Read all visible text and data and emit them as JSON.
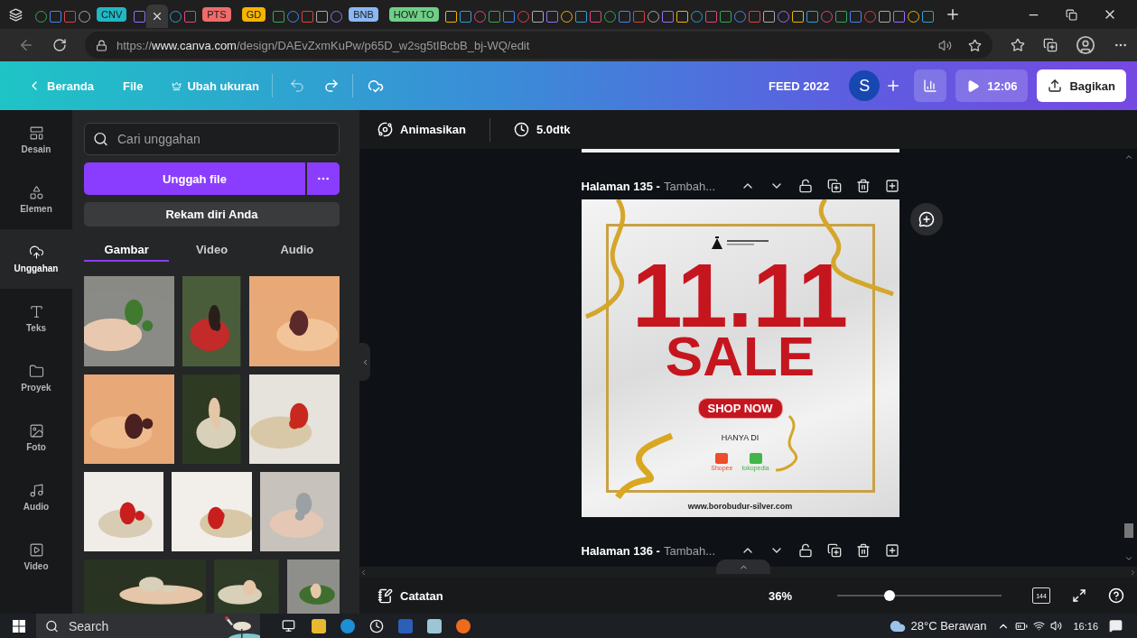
{
  "browser": {
    "tabs": [
      {
        "kind": "tab",
        "selected": false
      },
      {
        "kind": "tab",
        "selected": false
      },
      {
        "kind": "tab",
        "selected": false
      },
      {
        "kind": "tab",
        "selected": false
      },
      {
        "kind": "group",
        "label": "CNV",
        "color": "#20b8c4"
      },
      {
        "kind": "tab",
        "selected": false
      },
      {
        "kind": "tab",
        "selected": true
      },
      {
        "kind": "tab",
        "selected": false
      },
      {
        "kind": "tab",
        "selected": false
      },
      {
        "kind": "group",
        "label": "PTS",
        "color": "#f06b6b"
      },
      {
        "kind": "group",
        "label": "GD",
        "color": "#f5b400"
      },
      {
        "kind": "tab",
        "selected": false
      },
      {
        "kind": "tab",
        "selected": false
      },
      {
        "kind": "tab",
        "selected": false
      },
      {
        "kind": "tab",
        "selected": false
      },
      {
        "kind": "tab",
        "selected": false
      },
      {
        "kind": "group",
        "label": "BNB",
        "color": "#8ab8f5"
      },
      {
        "kind": "group",
        "label": "HOW TO",
        "color": "#6fcf86"
      },
      {
        "kind": "tab",
        "selected": false
      },
      {
        "kind": "tab",
        "selected": false
      },
      {
        "kind": "tab",
        "selected": false
      },
      {
        "kind": "tab",
        "selected": false
      },
      {
        "kind": "tab",
        "selected": false
      },
      {
        "kind": "tab",
        "selected": false
      },
      {
        "kind": "tab",
        "selected": false
      },
      {
        "kind": "tab",
        "selected": false
      },
      {
        "kind": "tab",
        "selected": false
      },
      {
        "kind": "tab",
        "selected": false
      },
      {
        "kind": "tab",
        "selected": false
      },
      {
        "kind": "tab",
        "selected": false
      },
      {
        "kind": "tab",
        "selected": false
      },
      {
        "kind": "tab",
        "selected": false
      },
      {
        "kind": "tab",
        "selected": false
      },
      {
        "kind": "tab",
        "selected": false
      },
      {
        "kind": "tab",
        "selected": false
      },
      {
        "kind": "tab",
        "selected": false
      },
      {
        "kind": "tab",
        "selected": false
      },
      {
        "kind": "tab",
        "selected": false
      },
      {
        "kind": "tab",
        "selected": false
      },
      {
        "kind": "tab",
        "selected": false
      },
      {
        "kind": "tab",
        "selected": false
      },
      {
        "kind": "tab",
        "selected": false
      },
      {
        "kind": "tab",
        "selected": false
      },
      {
        "kind": "tab",
        "selected": false
      },
      {
        "kind": "tab",
        "selected": false
      },
      {
        "kind": "tab",
        "selected": false
      },
      {
        "kind": "tab",
        "selected": false
      },
      {
        "kind": "tab",
        "selected": false
      },
      {
        "kind": "tab",
        "selected": false
      },
      {
        "kind": "tab",
        "selected": false
      },
      {
        "kind": "tab",
        "selected": false
      },
      {
        "kind": "tab",
        "selected": false
      }
    ],
    "url": {
      "scheme": "https://",
      "host": "www.canva.com",
      "path": "/design/DAEvZxmKuPw/p65D_w2sg5tIBcbB_bj-WQ/edit"
    }
  },
  "header": {
    "back_label": "Beranda",
    "file_label": "File",
    "resize_label": "Ubah ukuran",
    "design_title": "FEED 2022",
    "avatar": "S",
    "timer": "12:06",
    "share_label": "Bagikan"
  },
  "rail": [
    {
      "label": "Desain",
      "selected": false
    },
    {
      "label": "Elemen",
      "selected": false
    },
    {
      "label": "Unggahan",
      "selected": true
    },
    {
      "label": "Teks",
      "selected": false
    },
    {
      "label": "Proyek",
      "selected": false
    },
    {
      "label": "Foto",
      "selected": false
    },
    {
      "label": "Audio",
      "selected": false
    },
    {
      "label": "Video",
      "selected": false
    }
  ],
  "panel": {
    "search_placeholder": "Cari unggahan",
    "upload_label": "Unggah file",
    "record_label": "Rekam diri Anda",
    "tabs": [
      {
        "label": "Gambar",
        "selected": true
      },
      {
        "label": "Video",
        "selected": false
      },
      {
        "label": "Audio",
        "selected": false
      }
    ]
  },
  "canvas": {
    "animate_label": "Animasikan",
    "duration": "5.0dtk",
    "pages": [
      {
        "title": "Halaman 135 -",
        "subtitle": "Tambah...",
        "kind": "design"
      },
      {
        "title": "Halaman 136 -",
        "subtitle": "Tambah...",
        "kind": "edge"
      }
    ],
    "design": {
      "headline": "11.11",
      "subhead": "SALE",
      "cta": "SHOP NOW",
      "caption": "HANYA DI",
      "shops": [
        {
          "name": "Shopee",
          "color": "#ee4d2d"
        },
        {
          "name": "tokopedia",
          "color": "#42b549"
        }
      ],
      "website": "www.borobudur-silver.com"
    }
  },
  "footer": {
    "notes_label": "Catatan",
    "zoom": "36%",
    "zoom_slider": {
      "level": 0.32
    },
    "page_count": "144"
  },
  "taskbar": {
    "search_placeholder": "Search",
    "weather": "28°C Berawan",
    "time": "16:16"
  }
}
